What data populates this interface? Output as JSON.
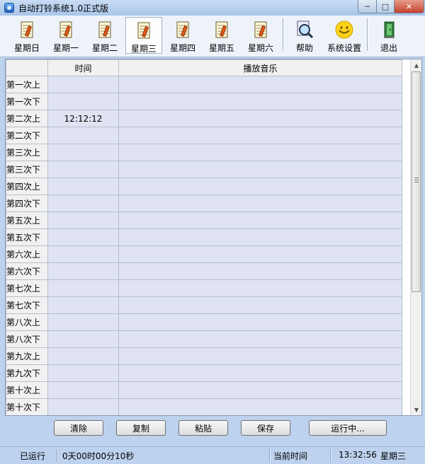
{
  "window": {
    "title": "自动打铃系统1.0正式版",
    "min_icon": "minimize-icon",
    "max_icon": "maximize-icon",
    "close_icon": "close-icon"
  },
  "toolbar": {
    "days": [
      "星期日",
      "星期一",
      "星期二",
      "星期三",
      "星期四",
      "星期五",
      "星期六"
    ],
    "active_day": "星期三",
    "help": "帮助",
    "settings": "系统设置",
    "exit": "退出"
  },
  "grid": {
    "headers": {
      "row": "",
      "time": "时间",
      "music": "播放音乐"
    },
    "rows": [
      {
        "label": "第一次上",
        "time": "",
        "music": ""
      },
      {
        "label": "第一次下",
        "time": "",
        "music": ""
      },
      {
        "label": "第二次上",
        "time": "12:12:12",
        "music": ""
      },
      {
        "label": "第二次下",
        "time": "",
        "music": ""
      },
      {
        "label": "第三次上",
        "time": "",
        "music": ""
      },
      {
        "label": "第三次下",
        "time": "",
        "music": ""
      },
      {
        "label": "第四次上",
        "time": "",
        "music": ""
      },
      {
        "label": "第四次下",
        "time": "",
        "music": ""
      },
      {
        "label": "第五次上",
        "time": "",
        "music": ""
      },
      {
        "label": "第五次下",
        "time": "",
        "music": ""
      },
      {
        "label": "第六次上",
        "time": "",
        "music": ""
      },
      {
        "label": "第六次下",
        "time": "",
        "music": ""
      },
      {
        "label": "第七次上",
        "time": "",
        "music": ""
      },
      {
        "label": "第七次下",
        "time": "",
        "music": ""
      },
      {
        "label": "第八次上",
        "time": "",
        "music": ""
      },
      {
        "label": "第八次下",
        "time": "",
        "music": ""
      },
      {
        "label": "第九次上",
        "time": "",
        "music": ""
      },
      {
        "label": "第九次下",
        "time": "",
        "music": ""
      },
      {
        "label": "第十次上",
        "time": "",
        "music": ""
      },
      {
        "label": "第十次下",
        "time": "",
        "music": ""
      }
    ]
  },
  "actions": {
    "clear": "清除",
    "copy": "复制",
    "paste": "粘贴",
    "save": "保存",
    "run": "运行中..."
  },
  "status": {
    "running_label": "已运行",
    "running_value": "0天00时00分10秒",
    "current_time_label": "当前时间",
    "current_time": "13:32:56",
    "current_day": "星期三"
  },
  "colors": {
    "grid_cell": "#dfe3f2",
    "header_bg": "#f1f1f1",
    "window_bg": "#bcd2ee"
  }
}
